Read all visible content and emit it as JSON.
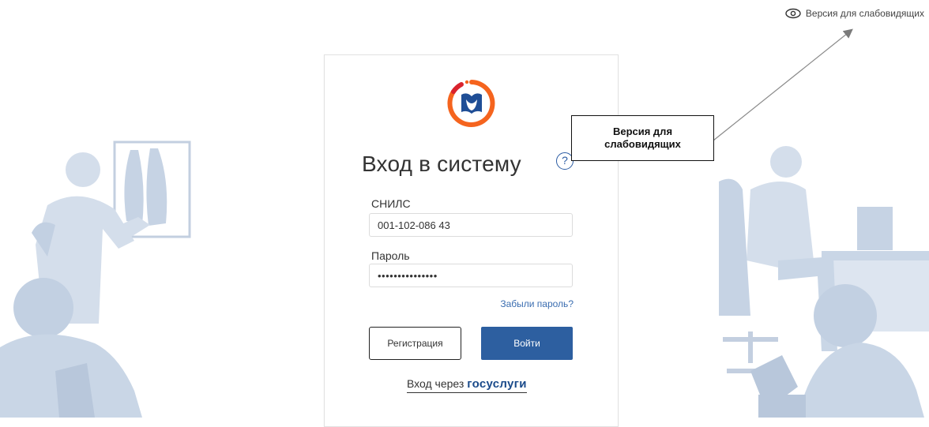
{
  "accessibility_link": {
    "label": "Версия для слабовидящих",
    "icon": "eye-icon"
  },
  "login_form": {
    "title": "Вход в систему",
    "help_icon": "?",
    "snils_label": "СНИЛС",
    "snils_value": "001-102-086 43",
    "password_label": "Пароль",
    "password_value": "•••••••••••••••",
    "forgot_password": "Забыли пароль?",
    "register_button": "Регистрация",
    "login_button": "Войти",
    "gosuslugi_prefix": "Вход через",
    "gosuslugi_brand": "госуслуги"
  },
  "annotation": {
    "line1": "Версия для",
    "line2": "слабовидящих"
  },
  "colors": {
    "primary": "#2d5fa0",
    "link": "#3a6db0",
    "logo_orange": "#f5641e",
    "logo_red": "#d9232d",
    "illustration": "#c9d6e6"
  }
}
